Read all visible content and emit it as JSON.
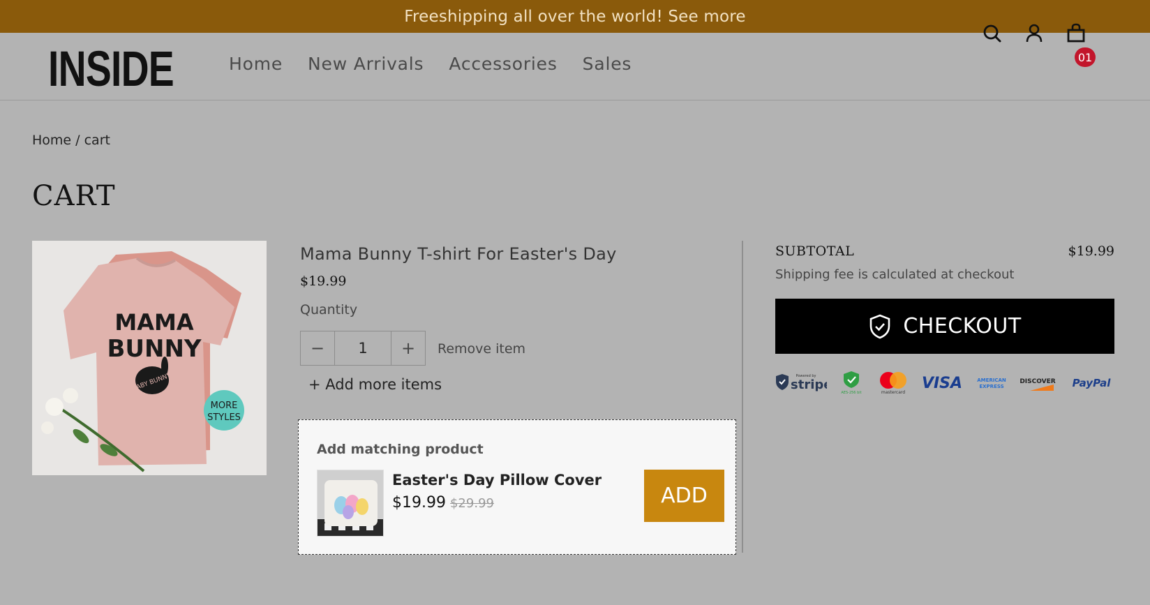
{
  "announcement": "Freeshipping all over the world! See more",
  "header": {
    "logo": "INSIDE",
    "nav": [
      "Home",
      "New Arrivals",
      "Accessories",
      "Sales"
    ],
    "cart_count": "01"
  },
  "breadcrumb": {
    "home": "Home",
    "separator": "/",
    "current": "cart"
  },
  "page_title": "CART",
  "cart_item": {
    "title": "Mama Bunny T-shirt For Easter's Day",
    "price": "$19.99",
    "quantity_label": "Quantity",
    "quantity": "1",
    "minus": "−",
    "plus": "+",
    "remove": "Remove item",
    "image_text": {
      "line1": "MAMA",
      "line2": "BUNNY",
      "baby": "BABY BUNNY",
      "badge1": "MORE",
      "badge2": "STYLES"
    }
  },
  "add_more": "+ Add more items",
  "matching": {
    "title": "Add matching product",
    "name": "Easter's Day Pillow Cover",
    "price": "$19.99",
    "old_price": "$29.99",
    "add_label": "ADD"
  },
  "summary": {
    "subtotal_label": "SUBTOTAL",
    "subtotal_value": "$19.99",
    "shipping_note": "Shipping fee is calculated at checkout",
    "checkout_label": "CHECKOUT"
  },
  "payments": {
    "stripe_small": "Powered by",
    "stripe": "stripe",
    "aes": "AES-256 bit",
    "mastercard": "mastercard",
    "visa": "VISA",
    "amex1": "AMERICAN",
    "amex2": "EXPRESS",
    "discover": "DISCOVER",
    "paypal": "PayPal"
  },
  "colors": {
    "announce_bg": "#8a5a0b",
    "page_bg": "#b3b3b3",
    "add_button": "#c8870f",
    "badge": "#c2152b",
    "checkout_bg": "#000000"
  }
}
